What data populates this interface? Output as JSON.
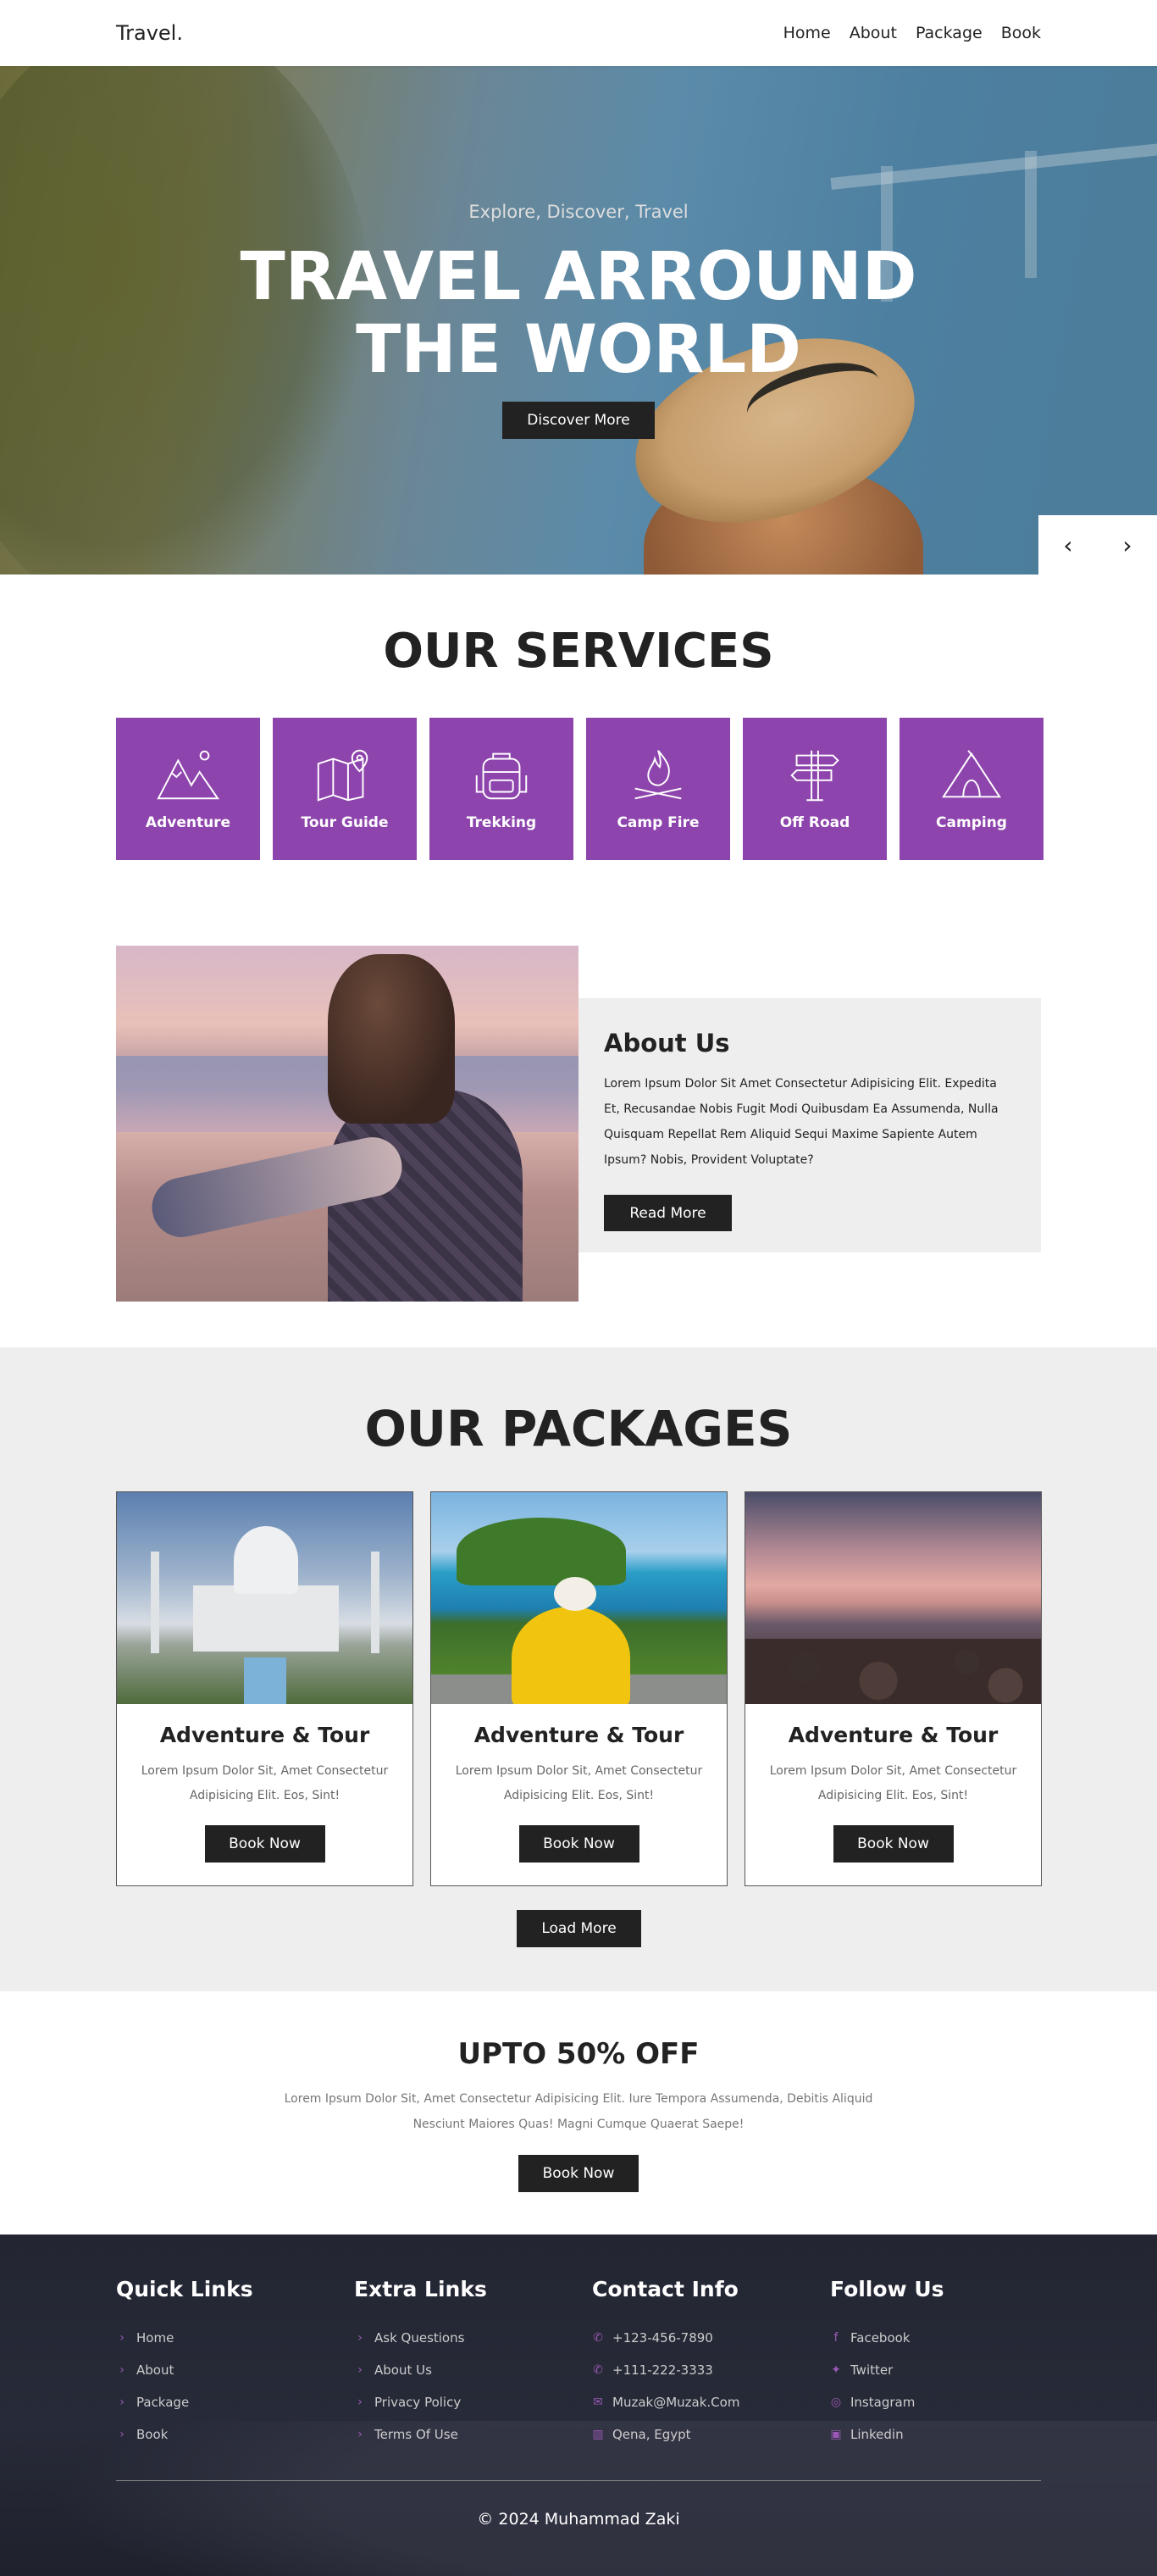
{
  "nav": {
    "logo": "Travel.",
    "links": [
      "Home",
      "About",
      "Package",
      "Book"
    ]
  },
  "hero": {
    "tagline": "Explore, Discover, Travel",
    "title_line1": "TRAVEL ARROUND",
    "title_line2": "THE WORLD",
    "button": "Discover More",
    "prev_icon": "chevron-left-icon",
    "next_icon": "chevron-right-icon"
  },
  "services": {
    "title": "OUR SERVICES",
    "items": [
      {
        "label": "Adventure",
        "icon": "mountain-icon"
      },
      {
        "label": "Tour Guide",
        "icon": "map-pin-icon"
      },
      {
        "label": "Trekking",
        "icon": "backpack-icon"
      },
      {
        "label": "Camp Fire",
        "icon": "campfire-icon"
      },
      {
        "label": "Off Road",
        "icon": "signpost-icon"
      },
      {
        "label": "Camping",
        "icon": "tent-icon"
      }
    ],
    "accent": "#8e44ad"
  },
  "about": {
    "title": "About Us",
    "text": "Lorem Ipsum Dolor Sit Amet Consectetur Adipisicing Elit. Expedita Et, Recusandae Nobis Fugit Modi Quibusdam Ea Assumenda, Nulla Quisquam Repellat Rem Aliquid Sequi Maxime Sapiente Autem Ipsum? Nobis, Provident Voluptate?",
    "button": "Read More"
  },
  "packages": {
    "title": "OUR PACKAGES",
    "cards": [
      {
        "title": "Adventure & Tour",
        "text": "Lorem Ipsum Dolor Sit, Amet Consectetur Adipisicing Elit. Eos, Sint!",
        "button": "Book Now"
      },
      {
        "title": "Adventure & Tour",
        "text": "Lorem Ipsum Dolor Sit, Amet Consectetur Adipisicing Elit. Eos, Sint!",
        "button": "Book Now"
      },
      {
        "title": "Adventure & Tour",
        "text": "Lorem Ipsum Dolor Sit, Amet Consectetur Adipisicing Elit. Eos, Sint!",
        "button": "Book Now"
      }
    ],
    "load_more": "Load More"
  },
  "offer": {
    "title": "UPTO 50% OFF",
    "text": "Lorem Ipsum Dolor Sit, Amet Consectetur Adipisicing Elit. Iure Tempora Assumenda, Debitis Aliquid Nesciunt Maiores Quas! Magni Cumque Quaerat Saepe!",
    "button": "Book Now"
  },
  "footer": {
    "quick_links": {
      "title": "Quick Links",
      "items": [
        "Home",
        "About",
        "Package",
        "Book"
      ]
    },
    "extra_links": {
      "title": "Extra Links",
      "items": [
        "Ask Questions",
        "About Us",
        "Privacy Policy",
        "Terms Of Use"
      ]
    },
    "contact": {
      "title": "Contact Info",
      "items": [
        "+123-456-7890",
        "+111-222-3333",
        "Muzak@Muzak.Com",
        "Qena, Egypt"
      ]
    },
    "follow": {
      "title": "Follow Us",
      "items": [
        "Facebook",
        "Twitter",
        "Instagram",
        "Linkedin"
      ]
    },
    "copyright": "© 2024 Muhammad Zaki"
  }
}
